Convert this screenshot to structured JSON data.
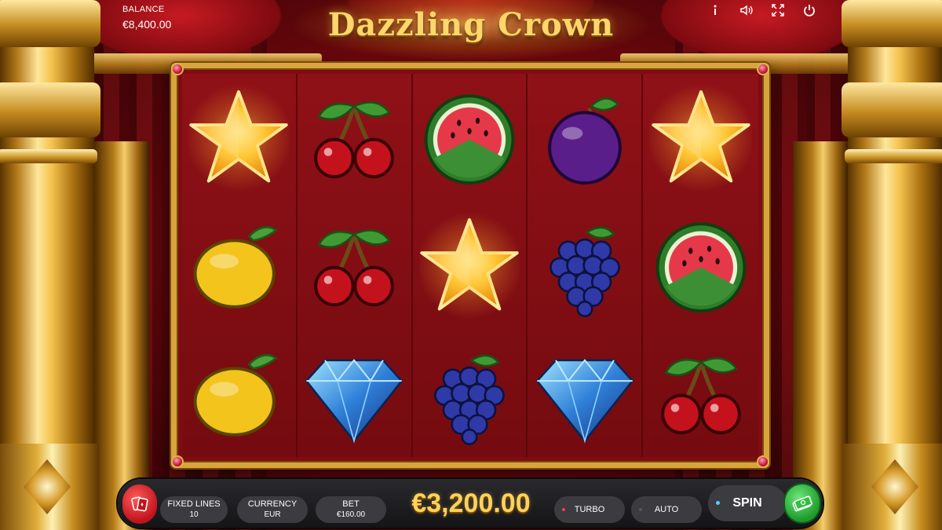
{
  "game": {
    "title": "Dazzling Crown"
  },
  "header": {
    "balance_label": "BALANCE",
    "balance_value": "€8,400.00",
    "icons": [
      "info-icon",
      "sound-icon",
      "fullscreen-icon",
      "power-icon"
    ]
  },
  "reels": [
    [
      "star",
      "lemon",
      "lemon"
    ],
    [
      "cherry",
      "cherry",
      "diamond"
    ],
    [
      "watermelon",
      "star",
      "grapes"
    ],
    [
      "plum",
      "grapes",
      "diamond"
    ],
    [
      "star",
      "watermelon",
      "cherry"
    ]
  ],
  "controls": {
    "fixed_lines_label": "FIXED LINES",
    "fixed_lines_value": "10",
    "currency_label": "CURRENCY",
    "currency_value": "EUR",
    "bet_label": "BET",
    "bet_value": "€160.00",
    "win_amount": "€3,200.00",
    "turbo_label": "TURBO",
    "auto_label": "AUTO",
    "spin_label": "SPIN"
  },
  "colors": {
    "gold": "#d8a53c",
    "reel_bg": "#7e0c12",
    "win_text": "#ffd25a",
    "rules_button": "#c0141c",
    "cash_button": "#1e9a2c",
    "turbo_indicator": "#ff3b5a",
    "auto_indicator": "#555555"
  }
}
